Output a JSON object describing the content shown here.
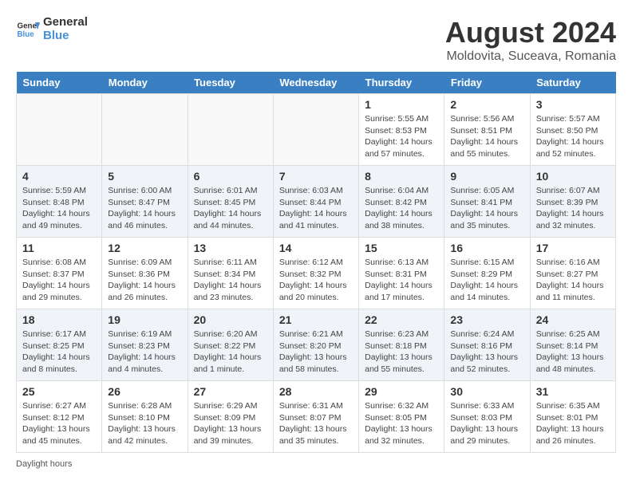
{
  "header": {
    "logo_general": "General",
    "logo_blue": "Blue",
    "month_title": "August 2024",
    "location": "Moldovita, Suceava, Romania"
  },
  "days_of_week": [
    "Sunday",
    "Monday",
    "Tuesday",
    "Wednesday",
    "Thursday",
    "Friday",
    "Saturday"
  ],
  "weeks": [
    {
      "row_class": "normal",
      "days": [
        {
          "number": "",
          "info": "",
          "empty": true
        },
        {
          "number": "",
          "info": "",
          "empty": true
        },
        {
          "number": "",
          "info": "",
          "empty": true
        },
        {
          "number": "",
          "info": "",
          "empty": true
        },
        {
          "number": "1",
          "info": "Sunrise: 5:55 AM\nSunset: 8:53 PM\nDaylight: 14 hours\nand 57 minutes."
        },
        {
          "number": "2",
          "info": "Sunrise: 5:56 AM\nSunset: 8:51 PM\nDaylight: 14 hours\nand 55 minutes."
        },
        {
          "number": "3",
          "info": "Sunrise: 5:57 AM\nSunset: 8:50 PM\nDaylight: 14 hours\nand 52 minutes."
        }
      ]
    },
    {
      "row_class": "alt",
      "days": [
        {
          "number": "4",
          "info": "Sunrise: 5:59 AM\nSunset: 8:48 PM\nDaylight: 14 hours\nand 49 minutes."
        },
        {
          "number": "5",
          "info": "Sunrise: 6:00 AM\nSunset: 8:47 PM\nDaylight: 14 hours\nand 46 minutes."
        },
        {
          "number": "6",
          "info": "Sunrise: 6:01 AM\nSunset: 8:45 PM\nDaylight: 14 hours\nand 44 minutes."
        },
        {
          "number": "7",
          "info": "Sunrise: 6:03 AM\nSunset: 8:44 PM\nDaylight: 14 hours\nand 41 minutes."
        },
        {
          "number": "8",
          "info": "Sunrise: 6:04 AM\nSunset: 8:42 PM\nDaylight: 14 hours\nand 38 minutes."
        },
        {
          "number": "9",
          "info": "Sunrise: 6:05 AM\nSunset: 8:41 PM\nDaylight: 14 hours\nand 35 minutes."
        },
        {
          "number": "10",
          "info": "Sunrise: 6:07 AM\nSunset: 8:39 PM\nDaylight: 14 hours\nand 32 minutes."
        }
      ]
    },
    {
      "row_class": "normal",
      "days": [
        {
          "number": "11",
          "info": "Sunrise: 6:08 AM\nSunset: 8:37 PM\nDaylight: 14 hours\nand 29 minutes."
        },
        {
          "number": "12",
          "info": "Sunrise: 6:09 AM\nSunset: 8:36 PM\nDaylight: 14 hours\nand 26 minutes."
        },
        {
          "number": "13",
          "info": "Sunrise: 6:11 AM\nSunset: 8:34 PM\nDaylight: 14 hours\nand 23 minutes."
        },
        {
          "number": "14",
          "info": "Sunrise: 6:12 AM\nSunset: 8:32 PM\nDaylight: 14 hours\nand 20 minutes."
        },
        {
          "number": "15",
          "info": "Sunrise: 6:13 AM\nSunset: 8:31 PM\nDaylight: 14 hours\nand 17 minutes."
        },
        {
          "number": "16",
          "info": "Sunrise: 6:15 AM\nSunset: 8:29 PM\nDaylight: 14 hours\nand 14 minutes."
        },
        {
          "number": "17",
          "info": "Sunrise: 6:16 AM\nSunset: 8:27 PM\nDaylight: 14 hours\nand 11 minutes."
        }
      ]
    },
    {
      "row_class": "alt",
      "days": [
        {
          "number": "18",
          "info": "Sunrise: 6:17 AM\nSunset: 8:25 PM\nDaylight: 14 hours\nand 8 minutes."
        },
        {
          "number": "19",
          "info": "Sunrise: 6:19 AM\nSunset: 8:23 PM\nDaylight: 14 hours\nand 4 minutes."
        },
        {
          "number": "20",
          "info": "Sunrise: 6:20 AM\nSunset: 8:22 PM\nDaylight: 14 hours\nand 1 minute."
        },
        {
          "number": "21",
          "info": "Sunrise: 6:21 AM\nSunset: 8:20 PM\nDaylight: 13 hours\nand 58 minutes."
        },
        {
          "number": "22",
          "info": "Sunrise: 6:23 AM\nSunset: 8:18 PM\nDaylight: 13 hours\nand 55 minutes."
        },
        {
          "number": "23",
          "info": "Sunrise: 6:24 AM\nSunset: 8:16 PM\nDaylight: 13 hours\nand 52 minutes."
        },
        {
          "number": "24",
          "info": "Sunrise: 6:25 AM\nSunset: 8:14 PM\nDaylight: 13 hours\nand 48 minutes."
        }
      ]
    },
    {
      "row_class": "normal",
      "days": [
        {
          "number": "25",
          "info": "Sunrise: 6:27 AM\nSunset: 8:12 PM\nDaylight: 13 hours\nand 45 minutes."
        },
        {
          "number": "26",
          "info": "Sunrise: 6:28 AM\nSunset: 8:10 PM\nDaylight: 13 hours\nand 42 minutes."
        },
        {
          "number": "27",
          "info": "Sunrise: 6:29 AM\nSunset: 8:09 PM\nDaylight: 13 hours\nand 39 minutes."
        },
        {
          "number": "28",
          "info": "Sunrise: 6:31 AM\nSunset: 8:07 PM\nDaylight: 13 hours\nand 35 minutes."
        },
        {
          "number": "29",
          "info": "Sunrise: 6:32 AM\nSunset: 8:05 PM\nDaylight: 13 hours\nand 32 minutes."
        },
        {
          "number": "30",
          "info": "Sunrise: 6:33 AM\nSunset: 8:03 PM\nDaylight: 13 hours\nand 29 minutes."
        },
        {
          "number": "31",
          "info": "Sunrise: 6:35 AM\nSunset: 8:01 PM\nDaylight: 13 hours\nand 26 minutes."
        }
      ]
    }
  ],
  "footer": {
    "note": "Daylight hours"
  }
}
